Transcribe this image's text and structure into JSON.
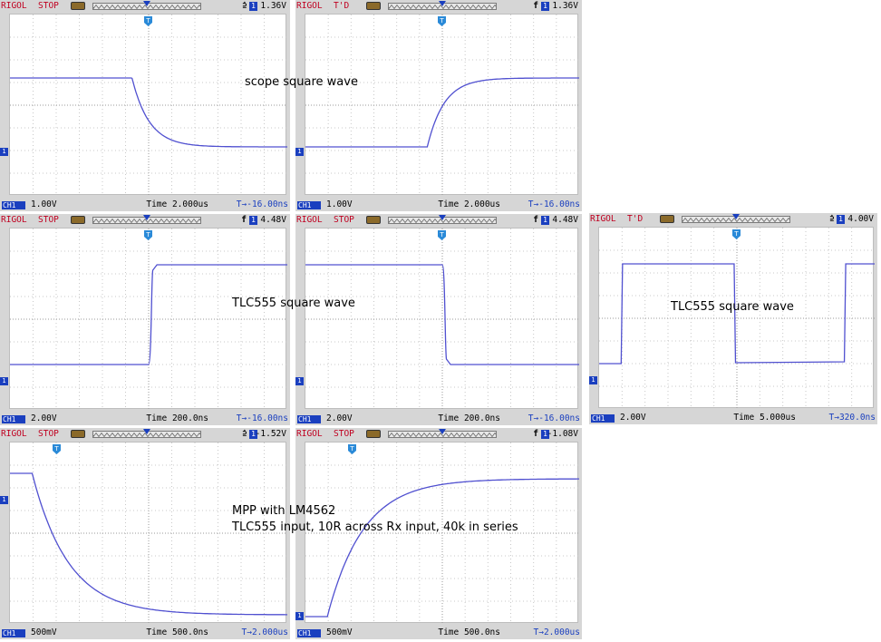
{
  "colors": {
    "trace": "#5050d0",
    "brand": "#c00020",
    "channel": "#1a3fbf",
    "bezel": "#d6d6d6"
  },
  "panels": [
    {
      "id": "p1",
      "brand": "RIGOL",
      "run_state": "STOP",
      "edge_icon": "falling-edge-icon",
      "edge_glyph": "⫄",
      "channel_num": "1",
      "trigger_level": "1.36V",
      "channel_tag": "CH1",
      "scale": "1.00V",
      "timebase": "Time 2.000us",
      "offset": "T→-16.00ns",
      "waveform": "falling-exponential"
    },
    {
      "id": "p2",
      "brand": "RIGOL",
      "run_state": "T'D",
      "edge_icon": "rising-edge-icon",
      "edge_glyph": "f",
      "channel_num": "1",
      "trigger_level": "1.36V",
      "channel_tag": "CH1",
      "scale": "1.00V",
      "timebase": "Time 2.000us",
      "offset": "T→-16.00ns",
      "waveform": "rising-exponential"
    },
    {
      "id": "p3",
      "brand": "RIGOL",
      "run_state": "STOP",
      "edge_icon": "rising-edge-icon",
      "edge_glyph": "f",
      "channel_num": "1",
      "trigger_level": "4.48V",
      "channel_tag": "CH1",
      "scale": "2.00V",
      "timebase": "Time 200.0ns",
      "offset": "T→-16.00ns",
      "waveform": "rising-step"
    },
    {
      "id": "p4",
      "brand": "RIGOL",
      "run_state": "STOP",
      "edge_icon": "rising-edge-icon",
      "edge_glyph": "f",
      "channel_num": "1",
      "trigger_level": "4.48V",
      "channel_tag": "CH1",
      "scale": "2.00V",
      "timebase": "Time 200.0ns",
      "offset": "T→-16.00ns",
      "waveform": "falling-step"
    },
    {
      "id": "p5",
      "brand": "RIGOL",
      "run_state": "T'D",
      "edge_icon": "falling-edge-icon",
      "edge_glyph": "⫄",
      "channel_num": "1",
      "trigger_level": "4.00V",
      "channel_tag": "CH1",
      "scale": "2.00V",
      "timebase": "Time 5.000us",
      "offset": "T→320.0ns",
      "waveform": "square"
    },
    {
      "id": "p6",
      "brand": "RIGOL",
      "run_state": "STOP",
      "edge_icon": "falling-edge-icon",
      "edge_glyph": "⫄",
      "channel_num": "1",
      "trigger_level": "-1.52V",
      "channel_tag": "CH1",
      "scale": "500mV",
      "timebase": "Time 500.0ns",
      "offset": "T→2.000us",
      "waveform": "falling-exponential-slow"
    },
    {
      "id": "p7",
      "brand": "RIGOL",
      "run_state": "STOP",
      "edge_icon": "rising-edge-icon",
      "edge_glyph": "f",
      "channel_num": "1",
      "trigger_level": "-1.08V",
      "channel_tag": "CH1",
      "scale": "500mV",
      "timebase": "Time 500.0ns",
      "offset": "T→2.000us",
      "waveform": "rising-exponential-slow"
    }
  ],
  "captions": {
    "c1": "scope square wave",
    "c2": "TLC555 square wave",
    "c3": "TLC555 square wave",
    "c4": "MPP with LM4562",
    "c5": "TLC555 input, 10R across Rx input, 40k in series"
  }
}
